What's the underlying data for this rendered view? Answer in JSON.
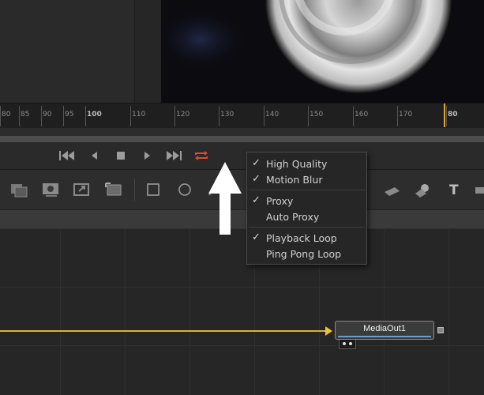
{
  "timeline": {
    "ticks": [
      "80",
      "85",
      "90",
      "95",
      "100",
      "110",
      "120",
      "130",
      "140",
      "150",
      "160",
      "170",
      "80"
    ],
    "major": [
      "100",
      "80"
    ]
  },
  "transport": {
    "buttons": [
      "skip-to-start",
      "step-back",
      "stop",
      "play",
      "skip-to-end",
      "loop"
    ],
    "loop_color": "#e0473a"
  },
  "menu": {
    "items": [
      {
        "label": "High Quality",
        "checked": true
      },
      {
        "label": "Motion Blur",
        "checked": true
      },
      {
        "label": "Proxy",
        "checked": true
      },
      {
        "label": "Auto Proxy",
        "checked": false
      },
      {
        "label": "Playback Loop",
        "checked": true
      },
      {
        "label": "Ping Pong Loop",
        "checked": false
      }
    ],
    "check_glyph": "✓"
  },
  "node": {
    "title": "MediaOut1",
    "accent": "#6b9ed3",
    "link_color": "#d7b23a"
  }
}
